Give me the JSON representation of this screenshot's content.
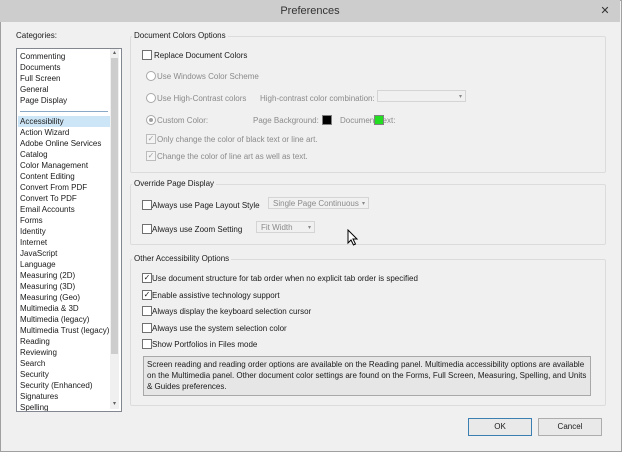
{
  "window": {
    "title": "Preferences",
    "close_glyph": "✕"
  },
  "categories": {
    "label": "Categories:",
    "pinned": [
      "Commenting",
      "Documents",
      "Full Screen",
      "General",
      "Page Display"
    ],
    "items": [
      "Accessibility",
      "Action Wizard",
      "Adobe Online Services",
      "Catalog",
      "Color Management",
      "Content Editing",
      "Convert From PDF",
      "Convert To PDF",
      "Email Accounts",
      "Forms",
      "Identity",
      "Internet",
      "JavaScript",
      "Language",
      "Measuring (2D)",
      "Measuring (3D)",
      "Measuring (Geo)",
      "Multimedia & 3D",
      "Multimedia (legacy)",
      "Multimedia Trust (legacy)",
      "Reading",
      "Reviewing",
      "Search",
      "Security",
      "Security (Enhanced)",
      "Signatures",
      "Spelling"
    ],
    "selected": "Accessibility"
  },
  "doc_colors": {
    "title": "Document Colors Options",
    "replace": {
      "label": "Replace Document Colors",
      "checked": false
    },
    "windows_scheme": {
      "label": "Use Windows Color Scheme"
    },
    "high_contrast": {
      "label": "Use High-Contrast colors",
      "combo_label": "High-contrast color combination:",
      "combo_value": ""
    },
    "custom": {
      "label": "Custom Color:",
      "page_bg_label": "Page Background:",
      "page_bg_color": "#000000",
      "doc_text_label": "Document Text:",
      "doc_text_color": "#22dd22"
    },
    "only_black": {
      "label": "Only change the color of black text or line art.",
      "checked": true
    },
    "line_art": {
      "label": "Change the color of line art as well as text.",
      "checked": true
    }
  },
  "override": {
    "title": "Override Page Display",
    "layout": {
      "label": "Always use Page Layout Style",
      "checked": false,
      "value": "Single Page Continuous"
    },
    "zoom": {
      "label": "Always use Zoom Setting",
      "checked": false,
      "value": "Fit Width"
    }
  },
  "other": {
    "title": "Other Accessibility Options",
    "options": [
      {
        "label": "Use document structure for tab order when no explicit tab order is specified",
        "checked": true
      },
      {
        "label": "Enable assistive technology support",
        "checked": true
      },
      {
        "label": "Always display the keyboard selection cursor",
        "checked": false
      },
      {
        "label": "Always use the system selection color",
        "checked": false
      },
      {
        "label": "Show Portfolios in Files mode",
        "checked": false
      }
    ],
    "info_text": "Screen reading and reading order options are available on the Reading panel. Multimedia accessibility options are available on the Multimedia panel. Other document color settings are found on the Forms, Full Screen, Measuring, Spelling, and Units & Guides preferences."
  },
  "buttons": {
    "ok": "OK",
    "cancel": "Cancel"
  },
  "glyphs": {
    "check": "✓",
    "dropdown": "▾",
    "scroll_up": "▴",
    "scroll_down": "▾"
  },
  "icons": {
    "cursor": "arrow-cursor-icon"
  }
}
